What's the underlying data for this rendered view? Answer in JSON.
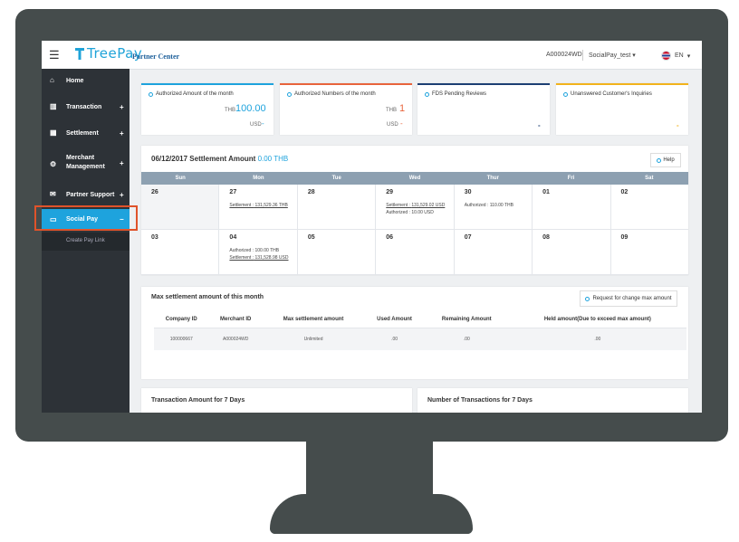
{
  "header": {
    "menu_icon": "☰",
    "logo_text": "TreePay",
    "partner_label": "Partner Center",
    "merchant_id": "A000024WD",
    "user_name": "SocialPay_test",
    "language": "EN"
  },
  "sidebar": {
    "items": [
      {
        "label": "Home",
        "icon": "home-icon",
        "glyph": "⌂"
      },
      {
        "label": "Transaction",
        "icon": "bar-chart-icon",
        "glyph": "▥",
        "plus": "+"
      },
      {
        "label": "Settlement",
        "icon": "calculator-icon",
        "glyph": "▦",
        "plus": "+"
      },
      {
        "label": "Merchant",
        "label2": "Management",
        "icon": "gear-icon",
        "glyph": "⚙",
        "plus": "+"
      },
      {
        "label": "Partner Support",
        "icon": "chat-icon",
        "glyph": "✉",
        "plus": "+"
      },
      {
        "label": "Social Pay",
        "icon": "card-icon",
        "glyph": "▭",
        "plus": "−"
      }
    ],
    "sub_item": "Create Pay Link"
  },
  "stats": [
    {
      "title": "Authorized Amount of the month",
      "cur1": "THB",
      "val1": "100.00",
      "cur2": "USD",
      "val2": "-",
      "color": "#1ea3dd"
    },
    {
      "title": "Authorized Numbers of the month",
      "cur1": "THB",
      "val1": "1",
      "cur2": "USD",
      "val2": "-",
      "color": "#e8643c"
    },
    {
      "title": "FDS Pending Reviews",
      "mini": "-",
      "color": "#1d3f73"
    },
    {
      "title": "Unanswered Customer's Inquiries",
      "mini": "-",
      "color": "#f2b31c"
    }
  ],
  "settlement": {
    "date": "06/12/2017",
    "label": "Settlement Amount",
    "amount": "0.00 THB",
    "help": "Help",
    "days": [
      "Sun",
      "Mon",
      "Tue",
      "Wed",
      "Thur",
      "Fri",
      "Sat"
    ],
    "week1": [
      {
        "num": "26",
        "off": true
      },
      {
        "num": "27",
        "l1_label": "Settlement :",
        "l1_value": "131,529.36 THB"
      },
      {
        "num": "28"
      },
      {
        "num": "29",
        "l1_label": "Settlement :",
        "l1_value": "131,529.02 USD",
        "l2_label": "Authorized :",
        "l2_value": "10.00 USD"
      },
      {
        "num": "30",
        "l1_label": "Authorized :",
        "l1_value": "110.00 THB",
        "plain": true
      },
      {
        "num": "01"
      },
      {
        "num": "02"
      }
    ],
    "week2": [
      {
        "num": "03"
      },
      {
        "num": "04",
        "l1_label": "Authorized :",
        "l1_value": "100.00 THB",
        "plain": true,
        "l2_label": "Settlement :",
        "l2_value": "131,528.98 USD",
        "l2_link": true
      },
      {
        "num": "05"
      },
      {
        "num": "06"
      },
      {
        "num": "07"
      },
      {
        "num": "08"
      },
      {
        "num": "09"
      }
    ]
  },
  "max_settlement": {
    "title": "Max settlement amount of this month",
    "request_button": "Request for change max amount",
    "columns": [
      "Company ID",
      "Merchant ID",
      "Max settlement amount",
      "Used Amount",
      "Remaining Amount",
      "Held amount(Due to exceed max amount)"
    ],
    "row": [
      "100000667",
      "A000024WD",
      "Unlimited",
      ".00",
      ".00",
      ".00"
    ]
  },
  "tx_amount_title": "Transaction Amount for 7 Days",
  "tx_count_title": "Number of Transactions for 7 Days",
  "colors": {
    "accent": "#1ea3dd",
    "sidebar": "#2d3237",
    "highlight": "#e0532a",
    "monitor": "#454c4c"
  }
}
